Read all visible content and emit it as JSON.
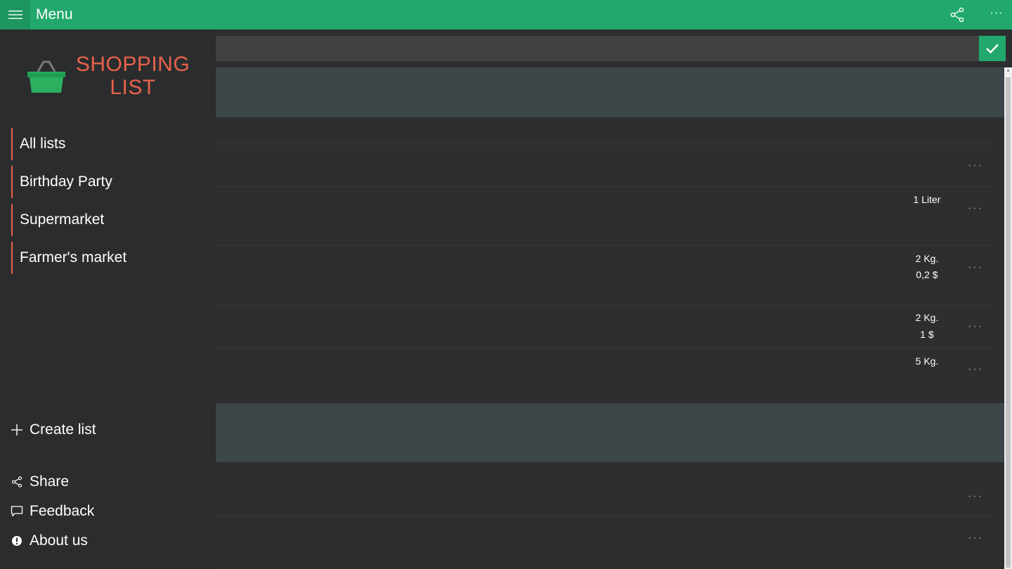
{
  "topbar": {
    "menu_icon": "hamburger-icon",
    "title": "Menu",
    "share_icon": "share-icon",
    "more_label": "···",
    "accent_color": "#22a86c"
  },
  "sidebar": {
    "logo_icon": "shopping-basket-icon",
    "logo_line1": "SHOPPING",
    "logo_line2": "LIST",
    "logo_color": "#e8624a",
    "lists": [
      {
        "label": "All lists"
      },
      {
        "label": "Birthday Party"
      },
      {
        "label": "Supermarket"
      },
      {
        "label": "Farmer's market"
      }
    ],
    "create_list": {
      "icon": "plus-icon",
      "label": "Create list"
    },
    "footer": [
      {
        "icon": "share-icon",
        "label": "Share"
      },
      {
        "icon": "feedback-icon",
        "label": "Feedback"
      },
      {
        "icon": "info-icon",
        "label": "About us"
      }
    ]
  },
  "main": {
    "search_value": "",
    "confirm_icon": "checkmark-icon",
    "more_label": "···",
    "groups": [
      {
        "name": "",
        "items": [
          {
            "quantity": "",
            "price": ""
          },
          {
            "quantity": "1 Liter",
            "price": ""
          },
          {
            "quantity": "2 Kg.",
            "price": "0,2 $"
          },
          {
            "quantity": "2 Kg.",
            "price": "1 $"
          },
          {
            "quantity": "5 Kg.",
            "price": ""
          }
        ]
      },
      {
        "name": "",
        "items": [
          {
            "quantity": "",
            "price": ""
          },
          {
            "quantity": "",
            "price": ""
          }
        ]
      }
    ]
  }
}
